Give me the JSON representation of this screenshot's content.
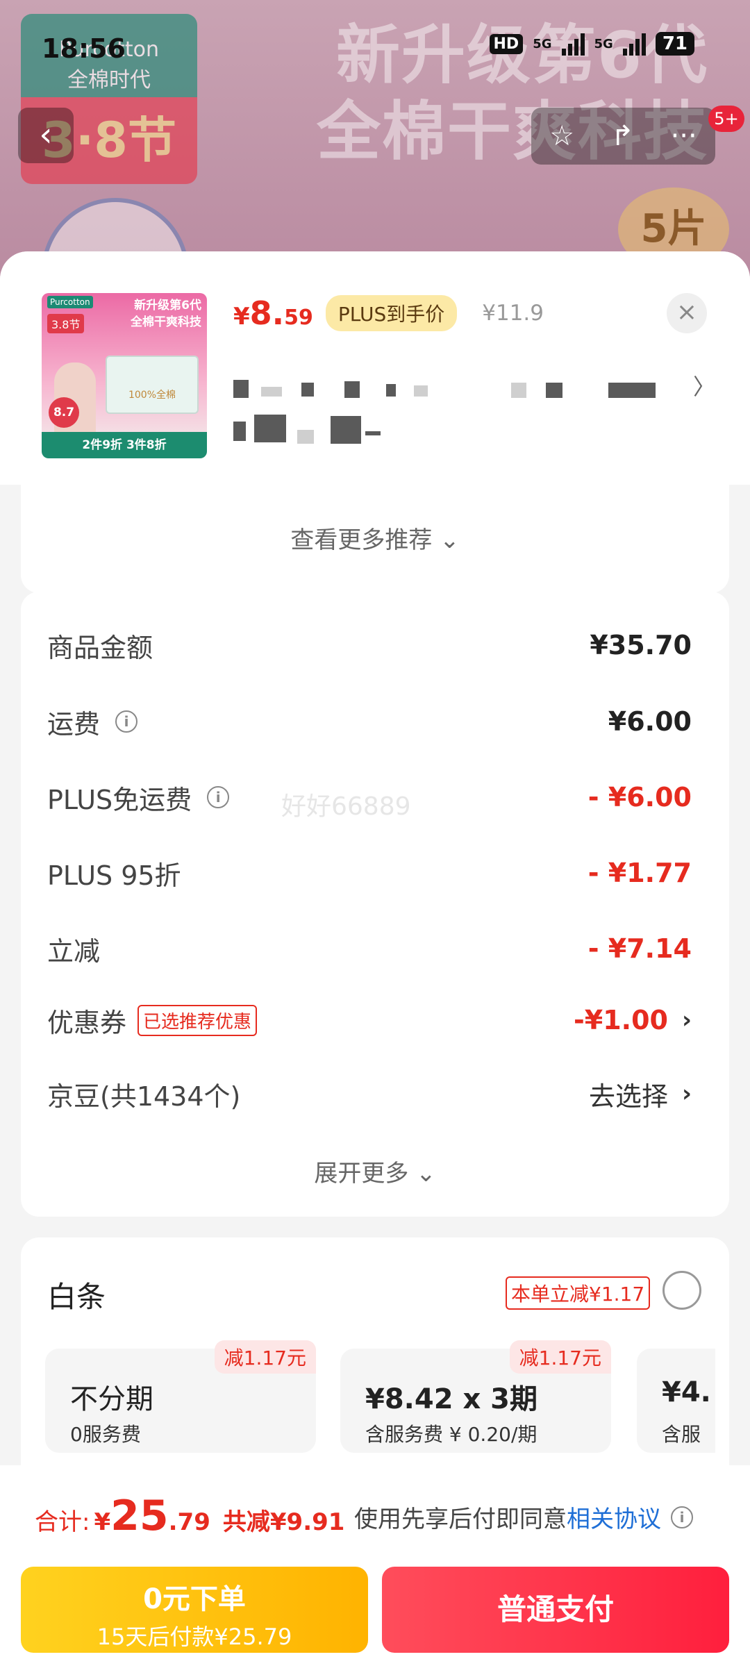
{
  "status_bar": {
    "time": "18:56",
    "hd": "HD",
    "net1": "5G",
    "net2": "5G",
    "battery": "71"
  },
  "background": {
    "brand_name": "Purcotton",
    "brand_sub": "全棉时代",
    "festival": "3·8节",
    "headline_line1": "新升级第6代",
    "headline_line2": "全棉干爽科技",
    "pack_count": "5片",
    "notif_count": "5+"
  },
  "product": {
    "price_yen": "¥",
    "price_int": "8.",
    "price_dec": "59",
    "plus_tag": "PLUS到手价",
    "original_price": "¥11.9",
    "thumb": {
      "brand": "Purcotton",
      "festival": "3.8节",
      "line1": "新升级第6代",
      "line2": "全棉干爽科技",
      "pack_label": "100%全棉",
      "promo": "2件9折 3件8折",
      "price_badge": "8.7"
    }
  },
  "more_recommend": "查看更多推荐 ⌄",
  "costs": {
    "rows": [
      {
        "label": "商品金额",
        "value": "¥35.70"
      },
      {
        "label": "运费",
        "value": "¥6.00"
      },
      {
        "label": "PLUS免运费",
        "value": "- ¥6.00"
      },
      {
        "label": "PLUS 95折",
        "value": "- ¥1.77"
      },
      {
        "label": "立减",
        "value": "- ¥7.14"
      },
      {
        "label": "优惠券",
        "tag": "已选推荐优惠",
        "value": "-¥1.00"
      },
      {
        "label": "京豆(共1434个)",
        "value": "去选择"
      }
    ],
    "expand_more": "展开更多 ⌄",
    "watermark": "好好66889"
  },
  "baitiao": {
    "title": "白条",
    "instant_discount": "本单立减¥1.17",
    "plans": [
      {
        "discount": "减1.17元",
        "main": "不分期",
        "sub": "0服务费"
      },
      {
        "discount": "减1.17元",
        "main": "¥8.42 x 3期",
        "sub": "含服务费 ¥ 0.20/期"
      },
      {
        "main": "¥4.",
        "sub": "含服"
      }
    ]
  },
  "footer": {
    "total_label": "合计:",
    "total_yen": "¥",
    "total_int": "25",
    "total_dec": ".79",
    "total_saving": "共减¥9.91",
    "agreement_prefix": "使用先享后付即同意",
    "agreement_link": "相关协议",
    "pay_later_line1": "0元下单",
    "pay_later_line2": "15天后付款¥25.79",
    "pay_normal": "普通支付"
  },
  "colors": {
    "accent_red": "#e62b1f",
    "pay_red": "#ff2d45",
    "pay_later_yellow": "#ffc107",
    "link_blue": "#1f6fd6"
  }
}
